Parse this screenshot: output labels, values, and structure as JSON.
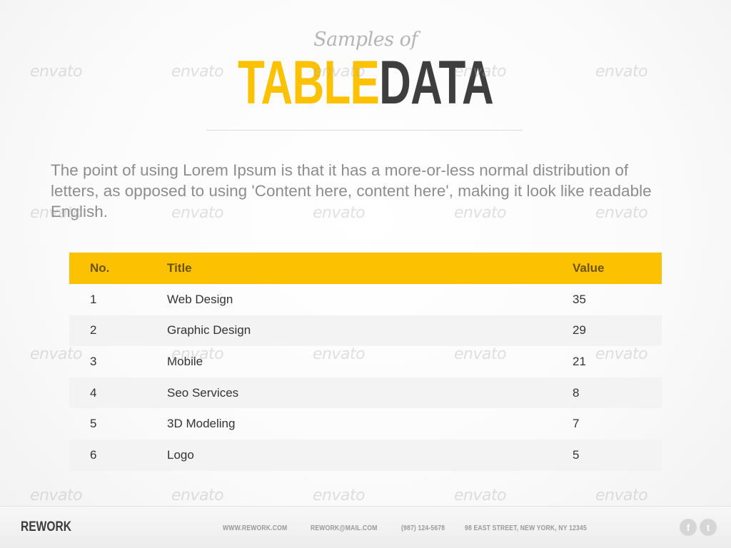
{
  "header": {
    "subtitle": "Samples of",
    "title_part1": "TABLE",
    "title_part2": "DATA"
  },
  "intro": "The point of using Lorem Ipsum is that it has a more-or-less normal distribution of letters, as opposed to using 'Content here, content here', making it look like readable English.",
  "table": {
    "columns": [
      "No.",
      "Title",
      "Value"
    ],
    "rows": [
      {
        "no": "1",
        "title": "Web Design",
        "value": "35"
      },
      {
        "no": "2",
        "title": "Graphic Design",
        "value": "29"
      },
      {
        "no": "3",
        "title": "Mobile",
        "value": "21"
      },
      {
        "no": "4",
        "title": "Seo Services",
        "value": "8"
      },
      {
        "no": "5",
        "title": "3D Modeling",
        "value": "7"
      },
      {
        "no": "6",
        "title": "Logo",
        "value": "5"
      }
    ]
  },
  "footer": {
    "brand": "REWORK",
    "website": "WWW.REWORK.COM",
    "email": "REWORK@MAIL.COM",
    "phone": "(987) 124-5678",
    "address": "98 EAST STREET, NEW YORK, NY 12345",
    "social": [
      {
        "icon": "facebook-icon",
        "glyph": "f"
      },
      {
        "icon": "twitter-icon",
        "glyph": "t"
      }
    ]
  },
  "watermark": "envato",
  "colors": {
    "accent": "#fcc100",
    "dark": "#3e3e3e",
    "header_text": "#6d5200",
    "row_alt": "#f3f3f3"
  }
}
